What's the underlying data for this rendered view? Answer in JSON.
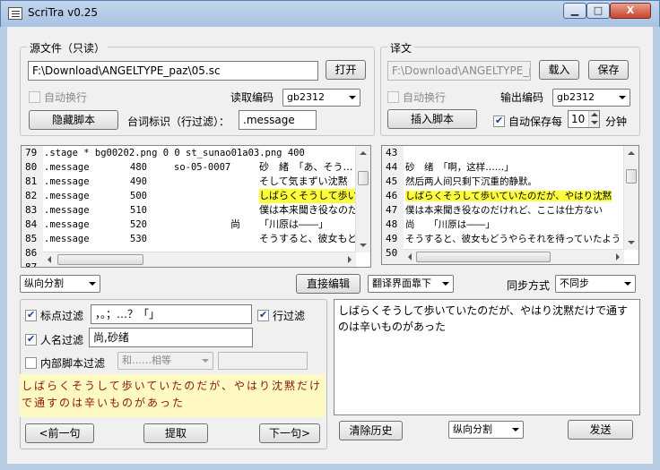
{
  "window": {
    "title": "ScriTra v0.25",
    "min_label": "▁",
    "max_label": "□",
    "close_label": "X"
  },
  "source": {
    "group_label": "源文件（只读）",
    "path": "F:\\Download\\ANGELTYPE_paz\\05.sc",
    "open_label": "打开",
    "auto_wrap_label": "自动换行",
    "read_encoding_label": "读取编码",
    "read_encoding_value": "gb2312",
    "hide_script_label": "隐藏脚本",
    "line_id_label": "台词标识（行过滤）：",
    "line_id_value": ".message",
    "lines": [
      {
        "num": "79",
        "a": ".stage * bg00202.png 0 0 st_sunao01a03.png 400",
        "b": "",
        "c": "",
        "d": "",
        "hl": false
      },
      {
        "num": "80",
        "a": ".message",
        "b": "480",
        "c": "so-05-0007",
        "d": "砂　緒　「あ、そう…",
        "hl": false
      },
      {
        "num": "81",
        "a": ".message",
        "b": "490",
        "c": "",
        "d": "そして気まずい沈黙",
        "hl": false
      },
      {
        "num": "82",
        "a": ".message",
        "b": "500",
        "c": "",
        "d": "しばらくそうして歩いて",
        "hl": true
      },
      {
        "num": "83",
        "a": ".message",
        "b": "510",
        "c": "",
        "d": "僕は本来聞き役なのだ",
        "hl": false
      },
      {
        "num": "84",
        "a": ".message",
        "b": "520",
        "c": "尚",
        "d": "「川原は――」",
        "hl": false
      },
      {
        "num": "85",
        "a": ".message",
        "b": "530",
        "c": "",
        "d": "そうすると、彼女もど",
        "hl": false
      },
      {
        "num": "86",
        "a": "",
        "b": "",
        "c": "",
        "d": "",
        "hl": false
      },
      {
        "num": "87",
        "a": "",
        "b": "",
        "c": "",
        "d": "",
        "hl": false
      }
    ]
  },
  "target": {
    "group_label": "译文",
    "path": "F:\\Download\\ANGELTYPE_p",
    "load_label": "载入",
    "save_label": "保存",
    "auto_wrap_label": "自动换行",
    "out_encoding_label": "输出编码",
    "out_encoding_value": "gb2312",
    "insert_script_label": "插入脚本",
    "autosave_label": "自动保存每",
    "autosave_value": "10",
    "minutes_label": "分钟",
    "lines": [
      {
        "num": "43",
        "text": "",
        "hl": false
      },
      {
        "num": "44",
        "text": "砂　绪　「啊，这样……」",
        "hl": false
      },
      {
        "num": "45",
        "text": "然后两人间只剩下沉重的静默。",
        "hl": false
      },
      {
        "num": "46",
        "text": "しばらくそうして歩いていたのだが、やはり沈黙",
        "hl": true
      },
      {
        "num": "47",
        "text": "僕は本来聞き役なのだけれど、ここは仕方ない",
        "hl": false
      },
      {
        "num": "48",
        "text": "尚　　「川原は――」",
        "hl": false
      },
      {
        "num": "49",
        "text": "そうすると、彼女もどうやらそれを待っていたよう",
        "hl": false
      },
      {
        "num": "50",
        "text": "",
        "hl": false
      }
    ]
  },
  "toolbar": {
    "split_value": "纵向分割",
    "direct_edit_label": "直接编辑",
    "translate_layout_value": "翻译界面靠下",
    "sync_label": "同步方式",
    "sync_value": "不同步"
  },
  "filters": {
    "punct_label": "标点过滤",
    "punct_value": "，。；…？「」",
    "line_filter_label": "行过滤",
    "name_label": "人名过滤",
    "name_value": "尚,砂绪",
    "inner_label": "内部脚本过滤",
    "inner_value": "和……相等",
    "preview": "しばらくそうして歩いていたのだが、やはり沈黙だけで通すのは辛いものがあった",
    "prev_label": "<前一句",
    "extract_label": "提取",
    "next_label": "下一句>"
  },
  "send": {
    "text": "しばらくそうして歩いていたのだが、やはり沈黙だけで通すのは辛いものがあった",
    "clear_label": "清除历史",
    "split_value": "纵向分割",
    "send_label": "发送"
  }
}
